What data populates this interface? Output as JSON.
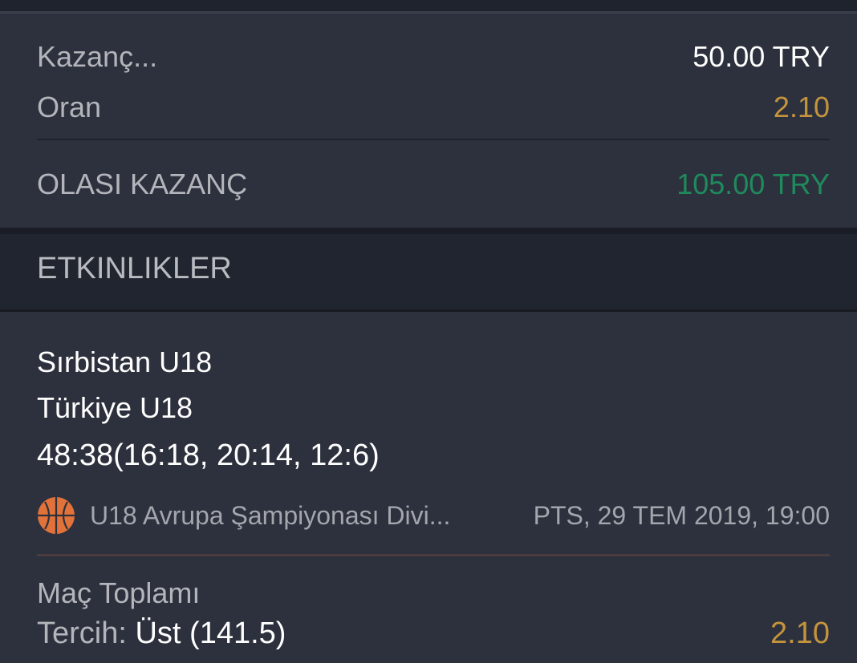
{
  "summary": {
    "stake_label": "Kazanç...",
    "stake_value": "50.00 TRY",
    "odds_label": "Oran",
    "odds_value": "2.10",
    "potential_label": "OLASI KAZANÇ",
    "potential_value": "105.00 TRY"
  },
  "events_section": {
    "title": "ETKINLIKLER"
  },
  "event": {
    "home_team": "Sırbistan U18",
    "away_team": "Türkiye U18",
    "score": "48:38(16:18, 20:14, 12:6)",
    "sport_icon": "basketball-icon",
    "league": "U18 Avrupa Şampiyonası Divi...",
    "datetime": "PTS, 29 TEM 2019, 19:00",
    "market": "Maç Toplamı",
    "pick_label": "Tercih: ",
    "pick_value": "Üst (141.5)",
    "pick_odds": "2.10"
  },
  "colors": {
    "background": "#2d313d",
    "header_background": "#21252f",
    "odds_gold": "#c4943d",
    "potential_green": "#1f8a5c",
    "basketball_orange": "#e0723a"
  }
}
